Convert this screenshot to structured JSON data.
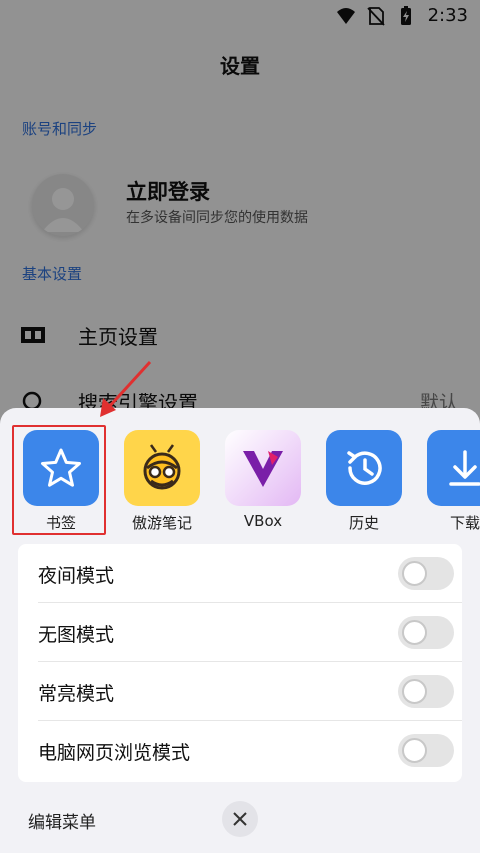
{
  "status_bar": {
    "time": "2:33"
  },
  "page": {
    "title": "设置",
    "account_section": "账号和同步",
    "login_title": "立即登录",
    "login_subtitle": "在多设备间同步您的使用数据",
    "basic_section": "基本设置",
    "rows": [
      {
        "label": "主页设置",
        "icon": "home-grid-icon"
      },
      {
        "label": "搜索引擎设置",
        "value": "默认",
        "icon": "search-icon"
      }
    ]
  },
  "sheet": {
    "apps": [
      {
        "label": "书签",
        "icon": "star-icon",
        "color": "#3c86ea"
      },
      {
        "label": "傲游笔记",
        "icon": "bee-icon",
        "color": "#ffd54a"
      },
      {
        "label": "VBox",
        "icon": "vbox-icon",
        "color": "#e9c8f5"
      },
      {
        "label": "历史",
        "icon": "history-icon",
        "color": "#3c86ea"
      },
      {
        "label": "下载",
        "icon": "download-icon",
        "color": "#3c86ea"
      }
    ],
    "toggles": [
      {
        "label": "夜间模式",
        "on": false
      },
      {
        "label": "无图模式",
        "on": false
      },
      {
        "label": "常亮模式",
        "on": false
      },
      {
        "label": "电脑网页浏览模式",
        "on": false
      }
    ],
    "edit_menu": "编辑菜单"
  },
  "colors": {
    "accent": "#3c86ea",
    "highlight": "#e03030",
    "section_label": "#2f6fd6"
  }
}
